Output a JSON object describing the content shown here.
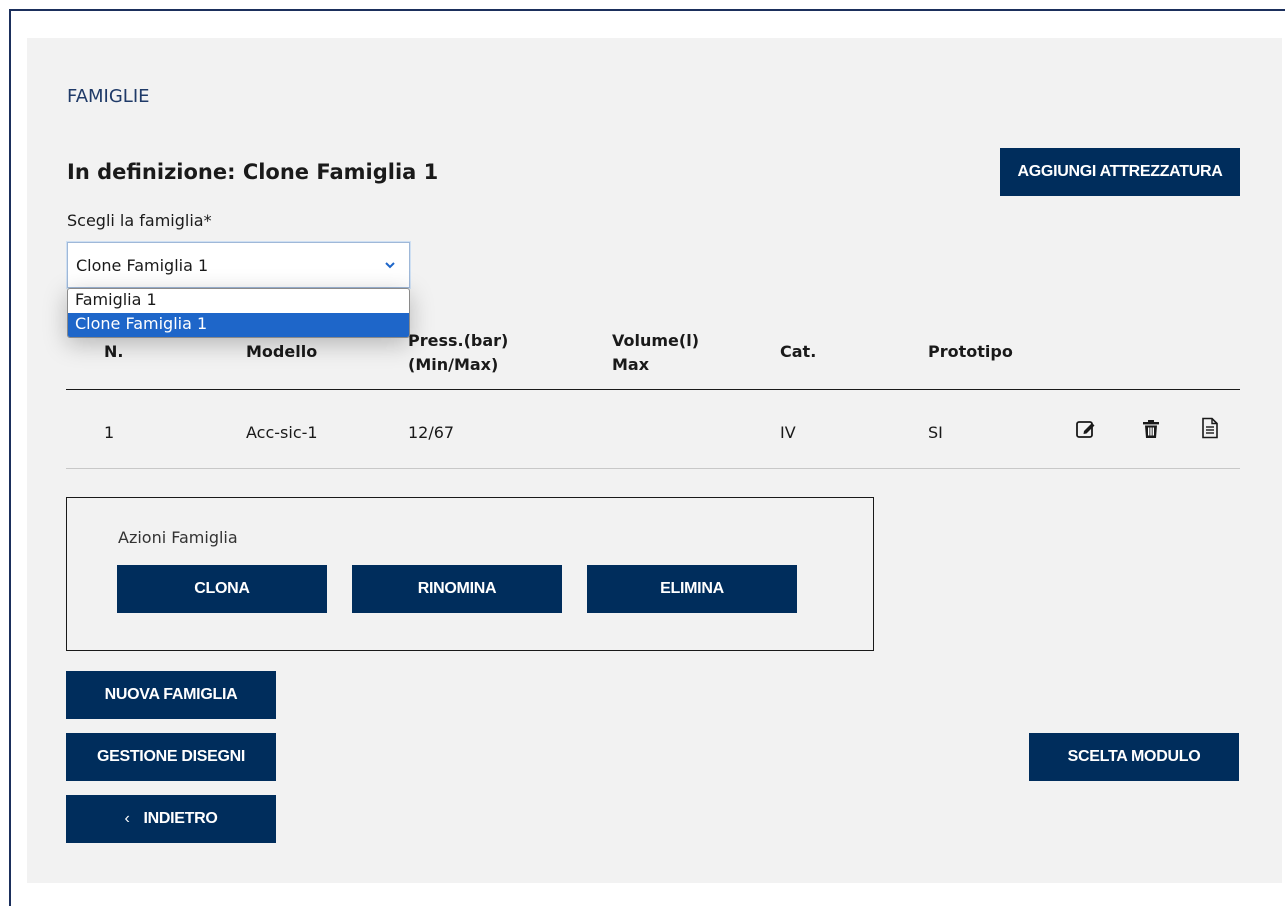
{
  "page": {
    "section_title": "FAMIGLIE",
    "definition_title": "In definizione: Clone Famiglia 1",
    "add_equipment_label": "AGGIUNGI ATTREZZATURA"
  },
  "family_select": {
    "label": "Scegli la famiglia*",
    "selected": "Clone Famiglia 1",
    "options": [
      "Famiglia 1",
      "Clone Famiglia 1"
    ]
  },
  "table": {
    "headers": {
      "n": "N.",
      "modello": "Modello",
      "press_1": "Press.(bar)",
      "press_2": "(Min/Max)",
      "volume_1": "Volume(l)",
      "volume_2": "Max",
      "cat": "Cat.",
      "prototipo": "Prototipo"
    },
    "rows": [
      {
        "n": "1",
        "modello": "Acc-sic-1",
        "press": "12/67",
        "volume": "",
        "cat": "IV",
        "prototipo": "SI"
      }
    ],
    "row_icons": [
      "edit-icon",
      "trash-icon",
      "document-icon"
    ]
  },
  "family_actions": {
    "label": "Azioni Famiglia",
    "clone": "CLONA",
    "rename": "RINOMINA",
    "delete": "ELIMINA"
  },
  "buttons": {
    "new_family": "NUOVA FAMIGLIA",
    "drawings": "GESTIONE DISEGNI",
    "back_arrow": "‹",
    "back": "INDIETRO",
    "module_choice": "SCELTA MODULO"
  },
  "colors": {
    "button_bg": "#002d5c",
    "panel_bg": "#f2f2f2",
    "selected_option": "#1e66c9",
    "frame_border": "#1b2f5c"
  }
}
